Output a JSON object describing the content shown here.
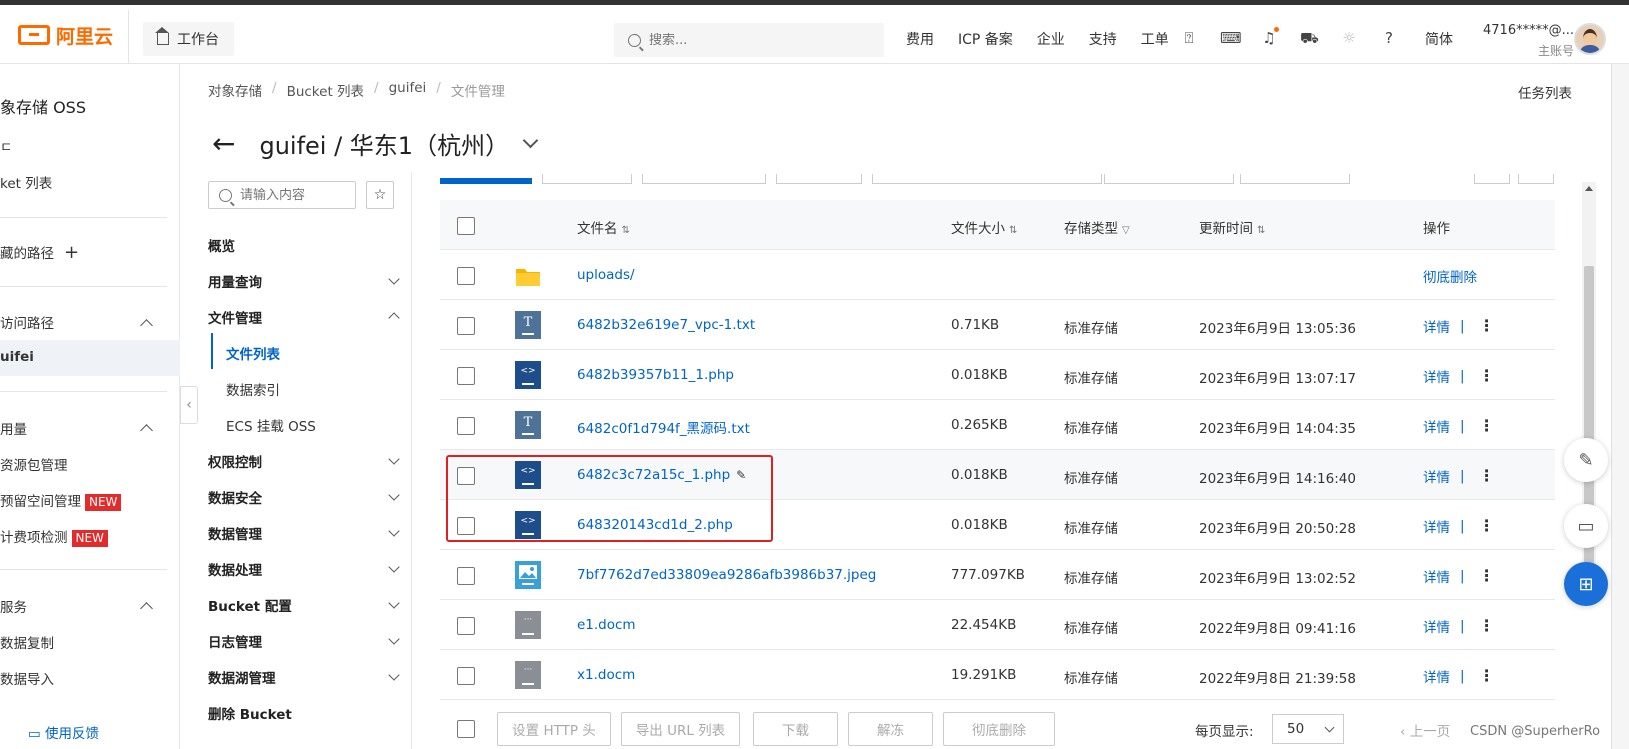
{
  "header": {
    "logo": "阿里云",
    "workbench": "工作台",
    "search_placeholder": "搜索...",
    "nav": [
      "费用",
      "ICP 备案",
      "企业",
      "支持",
      "工单"
    ],
    "icons": [
      "ai-assistant-icon",
      "terminal-icon",
      "bell-icon",
      "cart-icon",
      "lightbulb-icon",
      "help-icon"
    ],
    "lang": "简体",
    "account": "4716*****@...",
    "account_role": "主账号"
  },
  "sidebar": {
    "title": "象存储 OSS",
    "item_cut": "ㄷ",
    "bucket_list": "ket 列表",
    "favorites": "藏的路径",
    "access_path": "访问路径",
    "current_bucket": "uifei",
    "usage": "用量",
    "resource_pkg": "资源包管理",
    "reserved_space": "预留空间管理",
    "billing_check": "计费项检测",
    "new_badge": "NEW",
    "services": "服务",
    "data_replication": "数据复制",
    "data_import": "数据导入",
    "feedback": "使用反馈"
  },
  "breadcrumb": [
    "对象存储",
    "Bucket 列表",
    "guifei",
    "文件管理"
  ],
  "task_list": "任务列表",
  "page_title": "guifei / 华东1（杭州）",
  "menu": {
    "search_placeholder": "请输入内容",
    "overview": "概览",
    "usage_query": "用量查询",
    "file_mgmt": "文件管理",
    "file_list": "文件列表",
    "data_index": "数据索引",
    "ecs_mount": "ECS 挂载 OSS",
    "access_control": "权限控制",
    "data_security": "数据安全",
    "data_mgmt": "数据管理",
    "data_processing": "数据处理",
    "bucket_config": "Bucket 配置",
    "log_mgmt": "日志管理",
    "datalake_mgmt": "数据湖管理",
    "delete_bucket": "删除 Bucket"
  },
  "table": {
    "headers": {
      "name": "文件名",
      "size": "文件大小",
      "storage": "存储类型",
      "updated": "更新时间",
      "ops": "操作"
    },
    "rows": [
      {
        "icon": "folder-icon",
        "name": "uploads/",
        "size": "",
        "storage": "",
        "updated": "",
        "op": "彻底删除"
      },
      {
        "icon": "txt-file-icon",
        "name": "6482b32e619e7_vpc-1.txt",
        "size": "0.71KB",
        "storage": "标准存储",
        "updated": "2023年6月9日 13:05:36",
        "op": "详情"
      },
      {
        "icon": "code-file-icon",
        "name": "6482b39357b11_1.php",
        "size": "0.018KB",
        "storage": "标准存储",
        "updated": "2023年6月9日 13:07:17",
        "op": "详情"
      },
      {
        "icon": "txt-file-icon",
        "name": "6482c0f1d794f_黑源码.txt",
        "size": "0.265KB",
        "storage": "标准存储",
        "updated": "2023年6月9日 14:04:35",
        "op": "详情"
      },
      {
        "icon": "code-file-icon",
        "name": "6482c3c72a15c_1.php",
        "size": "0.018KB",
        "storage": "标准存储",
        "updated": "2023年6月9日 14:16:40",
        "op": "详情"
      },
      {
        "icon": "code-file-icon",
        "name": "648320143cd1d_2.php",
        "size": "0.018KB",
        "storage": "标准存储",
        "updated": "2023年6月9日 20:50:28",
        "op": "详情"
      },
      {
        "icon": "image-file-icon",
        "name": "7bf7762d7ed33809ea9286afb3986b37.jpeg",
        "size": "777.097KB",
        "storage": "标准存储",
        "updated": "2023年6月9日 13:02:52",
        "op": "详情"
      },
      {
        "icon": "doc-file-icon",
        "name": "e1.docm",
        "size": "22.454KB",
        "storage": "标准存储",
        "updated": "2022年9月8日 09:41:16",
        "op": "详情"
      },
      {
        "icon": "doc-file-icon",
        "name": "x1.docm",
        "size": "19.291KB",
        "storage": "标准存储",
        "updated": "2022年9月8日 21:39:58",
        "op": "详情"
      }
    ]
  },
  "footer": {
    "buttons": [
      "设置 HTTP 头",
      "导出 URL 列表",
      "下载",
      "解冻",
      "彻底删除"
    ],
    "page_size_label": "每页显示:",
    "page_size": "50",
    "prev": "上一页"
  },
  "watermark": "CSDN @SuperherRo",
  "colors": {
    "brand": "#ff6a00",
    "link": "#0064c8",
    "highlight_box": "#e02020",
    "fab_blue": "#1a6fd8"
  }
}
